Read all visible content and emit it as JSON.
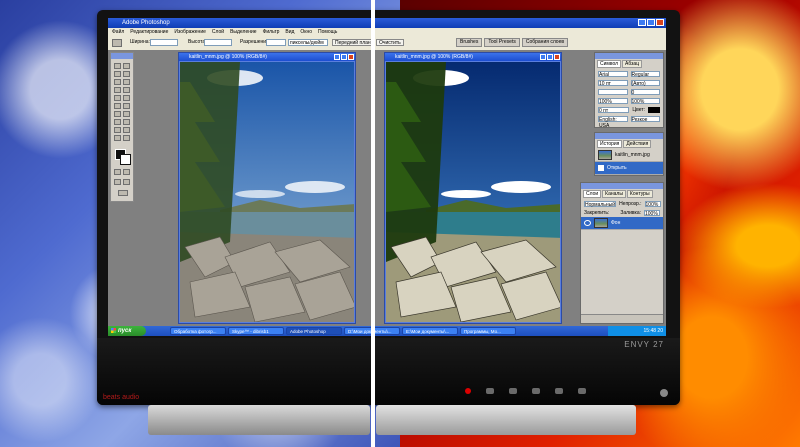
{
  "monitor": {
    "brand_label": "ENVY 27",
    "audio_label": "beats audio"
  },
  "photoshop": {
    "app_title": "Adobe Photoshop",
    "menu": [
      "Файл",
      "Редактирование",
      "Изображение",
      "Слой",
      "Выделение",
      "Фильтр",
      "Вид",
      "Окно",
      "Помощь"
    ],
    "options": {
      "width_label": "Ширина:",
      "height_label": "Высота:",
      "resolution_label": "Разрешение:",
      "units_value": "пикселы/дюйм",
      "front_image_button": "Передний план",
      "clear_button": "Очистить"
    },
    "palette_well_tabs": [
      "Brushes",
      "Tool Presets",
      "Собрания слоев"
    ],
    "doc_left_title": "kaitlin_mnm.jpg @ 100% (RGB/8#)",
    "doc_right_title": "kaitlin_mnm.jpg @ 100% (RGB/8#)",
    "character_palette": {
      "tabs": [
        "Символ",
        "Абзац"
      ],
      "font": "Arial",
      "style": "Regular",
      "size": "10 пт",
      "leading": "(Авто)",
      "tracking": "0",
      "scale_v": "100%",
      "scale_h": "100%",
      "baseline": "0 пт",
      "color_label": "Цвет:",
      "language": "English: USA",
      "aa": "Резкое"
    },
    "history_palette": {
      "tabs": [
        "История",
        "Действия"
      ],
      "snapshot": "kaitlin_mnm.jpg",
      "step": "Открыть"
    },
    "layers_palette": {
      "tabs": [
        "Слои",
        "Каналы",
        "Контуры"
      ],
      "mode": "Нормальный",
      "opacity_label": "Непрозр.:",
      "opacity": "100%",
      "lock_label": "Закрепить:",
      "fill_label": "Заливка:",
      "fill": "100%",
      "layer_name": "Фон"
    }
  },
  "taskbar": {
    "start_label": "пуск",
    "tasks": [
      "Обработка фотогр...",
      "Skype™ - dibrisb1",
      "Adobe Photoshop",
      "D:\\Мои документы\\...",
      "E:\\Мои документы\\...",
      "Программы, Мо..."
    ],
    "active_task_index": 2,
    "clock": "15:48 20"
  }
}
